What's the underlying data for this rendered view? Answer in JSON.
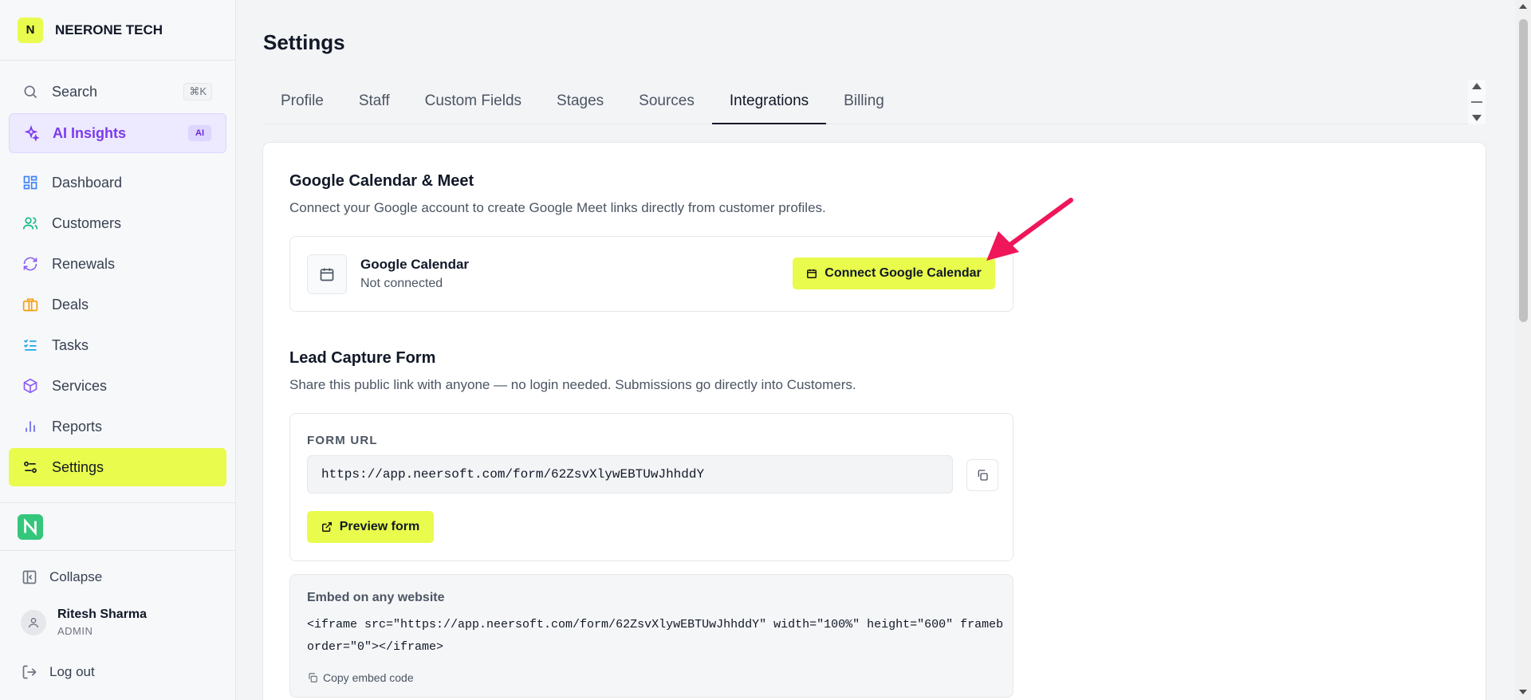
{
  "brand": {
    "logo_letter": "N",
    "name": "NEERONE TECH"
  },
  "sidebar": {
    "search": {
      "label": "Search",
      "shortcut": "⌘K"
    },
    "ai_insights": {
      "label": "AI Insights",
      "badge": "AI"
    },
    "items": [
      {
        "label": "Dashboard",
        "icon": "dashboard-icon"
      },
      {
        "label": "Customers",
        "icon": "users-icon"
      },
      {
        "label": "Renewals",
        "icon": "refresh-icon"
      },
      {
        "label": "Deals",
        "icon": "briefcase-icon"
      },
      {
        "label": "Tasks",
        "icon": "list-checks-icon"
      },
      {
        "label": "Services",
        "icon": "package-icon"
      },
      {
        "label": "Reports",
        "icon": "bar-chart-icon"
      },
      {
        "label": "Settings",
        "icon": "settings-icon",
        "active": true
      }
    ],
    "collapse_label": "Collapse",
    "user": {
      "name": "Ritesh Sharma",
      "role": "ADMIN"
    },
    "logout_label": "Log out"
  },
  "page": {
    "title": "Settings"
  },
  "tabs": [
    {
      "label": "Profile"
    },
    {
      "label": "Staff"
    },
    {
      "label": "Custom Fields"
    },
    {
      "label": "Stages"
    },
    {
      "label": "Sources"
    },
    {
      "label": "Integrations",
      "active": true
    },
    {
      "label": "Billing"
    }
  ],
  "google_calendar": {
    "title": "Google Calendar & Meet",
    "description": "Connect your Google account to create Google Meet links directly from customer profiles.",
    "name": "Google Calendar",
    "status": "Not connected",
    "connect_label": "Connect Google Calendar"
  },
  "lead_capture": {
    "title": "Lead Capture Form",
    "description": "Share this public link with anyone — no login needed. Submissions go directly into Customers.",
    "form_url_label": "FORM URL",
    "form_url": "https://app.neersoft.com/form/62ZsvXlywEBTUwJhhddY",
    "preview_label": "Preview form",
    "embed_title": "Embed on any website",
    "embed_code": "<iframe src=\"https://app.neersoft.com/form/62ZsvXlywEBTUwJhhddY\" width=\"100%\" height=\"600\" frameborder=\"0\"></iframe>",
    "copy_embed_label": "Copy embed code"
  },
  "colors": {
    "accent": "#e9fb4c",
    "ai_purple": "#7c3aed",
    "arrow": "#f0165a"
  }
}
